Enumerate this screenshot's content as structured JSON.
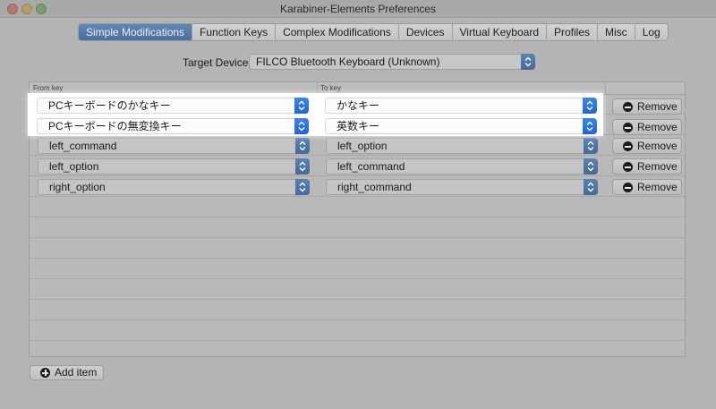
{
  "window": {
    "title": "Karabiner-Elements Preferences"
  },
  "tabs": [
    {
      "label": "Simple Modifications",
      "active": true
    },
    {
      "label": "Function Keys",
      "active": false
    },
    {
      "label": "Complex Modifications",
      "active": false
    },
    {
      "label": "Devices",
      "active": false
    },
    {
      "label": "Virtual Keyboard",
      "active": false
    },
    {
      "label": "Profiles",
      "active": false
    },
    {
      "label": "Misc",
      "active": false
    },
    {
      "label": "Log",
      "active": false
    }
  ],
  "target_device": {
    "label": "Target Device:",
    "value": "FILCO Bluetooth Keyboard (Unknown)"
  },
  "table": {
    "columns": {
      "from": "From key",
      "to": "To key"
    },
    "rows": [
      {
        "from": "PCキーボードのかなキー",
        "to": "かなキー",
        "remove": "Remove"
      },
      {
        "from": "PCキーボードの無変換キー",
        "to": "英数キー",
        "remove": "Remove"
      },
      {
        "from": "left_command",
        "to": "left_option",
        "remove": "Remove"
      },
      {
        "from": "left_option",
        "to": "left_command",
        "remove": "Remove"
      },
      {
        "from": "right_option",
        "to": "right_command",
        "remove": "Remove"
      }
    ]
  },
  "add_item": {
    "label": "Add item"
  },
  "colors": {
    "accent": "#2a6fdb",
    "highlight": "#ffffff"
  }
}
